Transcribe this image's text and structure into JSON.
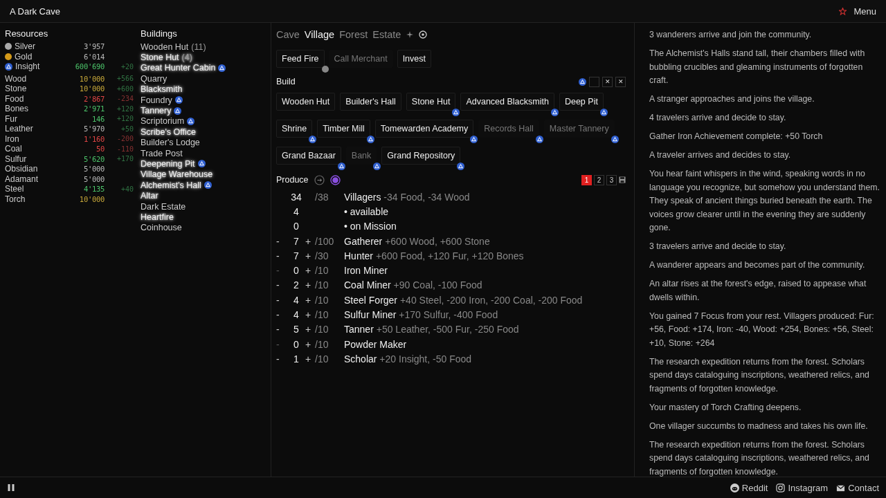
{
  "header": {
    "title": "A Dark Cave",
    "menu": "Menu"
  },
  "resources": {
    "title": "Resources",
    "items": [
      {
        "name": "Silver",
        "kind": "silver",
        "amount": "3'957",
        "capped": false,
        "short": false,
        "gaining": false
      },
      {
        "name": "Gold",
        "kind": "gold",
        "amount": "6'014",
        "capped": false,
        "short": false,
        "gaining": false
      },
      {
        "name": "Insight",
        "kind": "insight",
        "amount": "600'690",
        "capped": false,
        "short": false,
        "gaining": true,
        "rate": "+20",
        "falling": false
      },
      {
        "name": "Wood",
        "kind": "plain",
        "amount": "10'000",
        "capped": true,
        "short": false,
        "gaining": false,
        "rate": "+566",
        "falling": false
      },
      {
        "name": "Stone",
        "kind": "plain",
        "amount": "10'000",
        "capped": true,
        "short": false,
        "gaining": false,
        "rate": "+600",
        "falling": false
      },
      {
        "name": "Food",
        "kind": "plain",
        "amount": "2'867",
        "capped": false,
        "short": true,
        "gaining": false,
        "rate": "-234",
        "falling": true
      },
      {
        "name": "Bones",
        "kind": "plain",
        "amount": "2'971",
        "capped": false,
        "short": false,
        "gaining": true,
        "rate": "+120",
        "falling": false
      },
      {
        "name": "Fur",
        "kind": "plain",
        "amount": "146",
        "capped": false,
        "short": false,
        "gaining": true,
        "rate": "+120",
        "falling": false
      },
      {
        "name": "Leather",
        "kind": "plain",
        "amount": "5'970",
        "capped": false,
        "short": false,
        "gaining": false,
        "rate": "+50",
        "falling": false
      },
      {
        "name": "Iron",
        "kind": "plain",
        "amount": "1'160",
        "capped": false,
        "short": true,
        "gaining": false,
        "rate": "-200",
        "falling": true
      },
      {
        "name": "Coal",
        "kind": "plain",
        "amount": "50",
        "capped": false,
        "short": true,
        "gaining": false,
        "rate": "-110",
        "falling": true
      },
      {
        "name": "Sulfur",
        "kind": "plain",
        "amount": "5'620",
        "capped": false,
        "short": false,
        "gaining": true,
        "rate": "+170",
        "falling": false
      },
      {
        "name": "Obsidian",
        "kind": "plain",
        "amount": "5'000",
        "capped": false,
        "short": false,
        "gaining": false
      },
      {
        "name": "Adamant",
        "kind": "plain",
        "amount": "5'000",
        "capped": false,
        "short": false,
        "gaining": false
      },
      {
        "name": "Steel",
        "kind": "plain",
        "amount": "4'135",
        "capped": false,
        "short": false,
        "gaining": true,
        "rate": "+40",
        "falling": false
      },
      {
        "name": "Torch",
        "kind": "plain",
        "amount": "10'000",
        "capped": true,
        "short": false,
        "gaining": false
      }
    ]
  },
  "buildings": {
    "title": "Buildings",
    "items": [
      {
        "name": "Wooden Hut",
        "count": "(11)",
        "glow": false,
        "insight": false
      },
      {
        "name": "Stone Hut",
        "count": "(4)",
        "glow": true,
        "insight": false
      },
      {
        "name": "Great Hunter Cabin",
        "glow": true,
        "insight": true
      },
      {
        "name": "Quarry",
        "glow": false,
        "insight": false
      },
      {
        "name": "Blacksmith",
        "glow": true,
        "insight": false
      },
      {
        "name": "Foundry",
        "glow": false,
        "insight": true
      },
      {
        "name": "Tannery",
        "glow": true,
        "insight": true
      },
      {
        "name": "Scriptorium",
        "glow": false,
        "insight": true
      },
      {
        "name": "Scribe's Office",
        "glow": true,
        "insight": false
      },
      {
        "name": "Builder's Lodge",
        "glow": false,
        "insight": false
      },
      {
        "name": "Trade Post",
        "glow": false,
        "insight": false
      },
      {
        "name": "Deepening Pit",
        "glow": true,
        "insight": true
      },
      {
        "name": "Village Warehouse",
        "glow": true,
        "insight": false
      },
      {
        "name": "Alchemist's Hall",
        "glow": true,
        "insight": true
      },
      {
        "name": "Altar",
        "glow": true,
        "insight": false
      },
      {
        "name": "Dark Estate",
        "glow": false,
        "insight": false
      },
      {
        "name": "Heartfire",
        "glow": true,
        "insight": false
      },
      {
        "name": "Coinhouse",
        "glow": false,
        "insight": false
      }
    ]
  },
  "tabs": [
    {
      "label": "Cave",
      "selected": false
    },
    {
      "label": "Village",
      "selected": true
    },
    {
      "label": "Forest",
      "selected": false
    },
    {
      "label": "Estate",
      "selected": false
    }
  ],
  "actions": [
    {
      "label": "Feed Fire",
      "disabled": false,
      "cooldown": true
    },
    {
      "label": "Call Merchant",
      "disabled": true,
      "cooldown": false
    },
    {
      "label": "Invest",
      "disabled": false,
      "cooldown": false
    }
  ],
  "build": {
    "title": "Build",
    "tools": [
      "✕",
      "✕"
    ],
    "items": [
      {
        "label": "Wooden Hut",
        "disabled": false,
        "insight": false
      },
      {
        "label": "Builder's Hall",
        "disabled": false,
        "insight": false
      },
      {
        "label": "Stone Hut",
        "disabled": false,
        "insight": true
      },
      {
        "label": "Advanced Blacksmith",
        "disabled": false,
        "insight": true
      },
      {
        "label": "Deep Pit",
        "disabled": false,
        "insight": true
      },
      {
        "label": "Shrine",
        "disabled": false,
        "insight": true
      },
      {
        "label": "Timber Mill",
        "disabled": false,
        "insight": true
      },
      {
        "label": "Tomewarden Academy",
        "disabled": false,
        "insight": true
      },
      {
        "label": "Records Hall",
        "disabled": true,
        "insight": true
      },
      {
        "label": "Master Tannery",
        "disabled": true,
        "insight": true
      },
      {
        "label": "Grand Bazaar",
        "disabled": false,
        "insight": true
      },
      {
        "label": "Bank",
        "disabled": true,
        "insight": true
      },
      {
        "label": "Grand Repository",
        "disabled": false,
        "insight": true
      }
    ]
  },
  "produce": {
    "title": "Produce",
    "pages": [
      {
        "label": "1",
        "selected": true
      },
      {
        "label": "2",
        "selected": false
      },
      {
        "label": "3",
        "selected": false
      }
    ],
    "rows": [
      {
        "kind": "total",
        "count": "34",
        "max": "/38",
        "name": "Villagers",
        "effect": "-34 Food, -34 Wood"
      },
      {
        "kind": "sub",
        "count": "4",
        "name": "• available"
      },
      {
        "kind": "sub",
        "count": "0",
        "name": "• on Mission"
      },
      {
        "kind": "worker",
        "minus": "-",
        "count": "7",
        "plus": "+",
        "max": "/100",
        "name": "Gatherer",
        "effect": "+600 Wood, +600 Stone",
        "can_decrease": true
      },
      {
        "kind": "worker",
        "minus": "-",
        "count": "7",
        "plus": "+",
        "max": "/30",
        "name": "Hunter",
        "effect": "+600 Food, +120 Fur, +120 Bones",
        "can_decrease": true
      },
      {
        "kind": "worker",
        "minus": "-",
        "count": "0",
        "plus": "+",
        "max": "/10",
        "name": "Iron Miner",
        "can_decrease": false
      },
      {
        "kind": "worker",
        "minus": "-",
        "count": "2",
        "plus": "+",
        "max": "/10",
        "name": "Coal Miner",
        "effect": "+90 Coal, -100 Food",
        "can_decrease": true
      },
      {
        "kind": "worker",
        "minus": "-",
        "count": "4",
        "plus": "+",
        "max": "/10",
        "name": "Steel Forger",
        "effect": "+40 Steel, -200 Iron, -200 Coal, -200 Food",
        "can_decrease": true
      },
      {
        "kind": "worker",
        "minus": "-",
        "count": "4",
        "plus": "+",
        "max": "/10",
        "name": "Sulfur Miner",
        "effect": "+170 Sulfur, -400 Food",
        "can_decrease": true
      },
      {
        "kind": "worker",
        "minus": "-",
        "count": "5",
        "plus": "+",
        "max": "/10",
        "name": "Tanner",
        "effect": "+50 Leather, -500 Fur, -250 Food",
        "can_decrease": true
      },
      {
        "kind": "worker",
        "minus": "-",
        "count": "0",
        "plus": "+",
        "max": "/10",
        "name": "Powder Maker",
        "can_decrease": false
      },
      {
        "kind": "worker",
        "minus": "-",
        "count": "1",
        "plus": "+",
        "max": "/10",
        "name": "Scholar",
        "effect": "+20 Insight, -50 Food",
        "can_decrease": true
      }
    ]
  },
  "log": [
    "3 wanderers arrive and join the community.",
    "The Alchemist's Halls stand tall, their chambers filled with bubbling crucibles and gleaming instruments of forgotten craft.",
    "A stranger approaches and joins the village.",
    "4 travelers arrive and decide to stay.",
    "Gather Iron Achievement complete: +50 Torch",
    "A traveler arrives and decides to stay.",
    "You hear faint whispers in the wind, speaking words in no language you recognize, but somehow you understand them. They speak of ancient things buried beneath the earth. The voices grow clearer until in the evening they are suddenly gone.",
    "3 travelers arrive and decide to stay.",
    "A wanderer appears and becomes part of the community.",
    "An altar rises at the forest's edge, raised to appease what dwells within.",
    "You gained 7 Focus from your rest. Villagers produced: Fur: +56, Food: +174, Iron: -40, Wood: +254, Bones: +56, Steel: +10, Stone: +264",
    "The research expedition returns from the forest. Scholars spend days cataloguing inscriptions, weathered relics, and fragments of forgotten knowledge.",
    "Your mastery of Torch Crafting deepens.",
    "One villager succumbs to madness and takes his own life.",
    "The research expedition returns from the forest. Scholars spend days cataloguing inscriptions, weathered relics, and fragments of forgotten knowledge."
  ],
  "footer": {
    "links": [
      {
        "label": "Reddit",
        "kind": "reddit"
      },
      {
        "label": "Instagram",
        "kind": "instagram"
      },
      {
        "label": "Contact",
        "kind": "mail"
      }
    ]
  }
}
